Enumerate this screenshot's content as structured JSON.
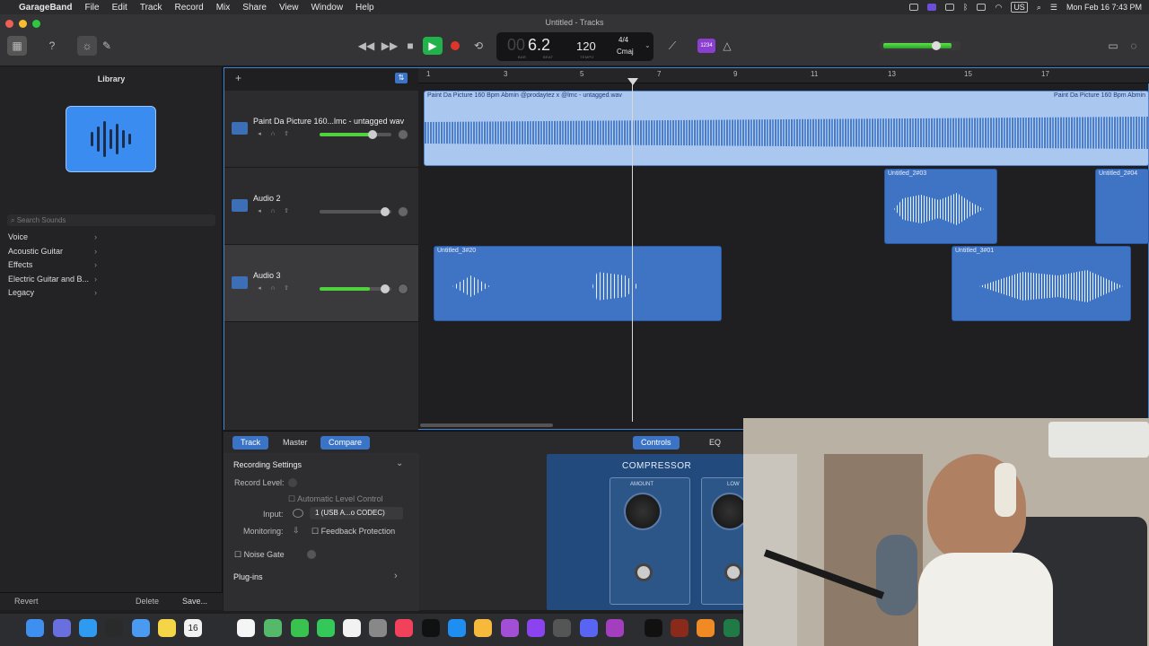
{
  "menubar": {
    "apple": "",
    "app": "GarageBand",
    "items": [
      "File",
      "Edit",
      "Track",
      "Record",
      "Mix",
      "Share",
      "View",
      "Window",
      "Help"
    ],
    "input_source": "US",
    "datetime": "Mon Feb 16  7:43 PM"
  },
  "window": {
    "title": "Untitled - Tracks"
  },
  "lcd": {
    "position": "6.2",
    "position_dim": "00",
    "bar_label": "BAR",
    "beat_label": "BEAT",
    "tempo": "120",
    "tempo_label": "TEMPO",
    "signature": "4/4",
    "key": "Cmaj"
  },
  "count_in_label": "1234",
  "library": {
    "title": "Library",
    "search_placeholder": "Search Sounds",
    "items": [
      {
        "label": "Voice"
      },
      {
        "label": "Acoustic Guitar"
      },
      {
        "label": "Effects"
      },
      {
        "label": "Electric Guitar and B..."
      },
      {
        "label": "Legacy"
      }
    ],
    "revert": "Revert",
    "delete": "Delete",
    "save": "Save..."
  },
  "ruler": {
    "ticks": [
      "1",
      "3",
      "5",
      "7",
      "9",
      "11",
      "13",
      "15",
      "17"
    ]
  },
  "tracks": [
    {
      "name": "Paint Da Picture 160...lmc - untagged wav",
      "volume": 0.75
    },
    {
      "name": "Audio 2",
      "volume": 0.9
    },
    {
      "name": "Audio 3",
      "volume": 0.9
    }
  ],
  "regions": {
    "main_left": "Paint Da Picture 160 Bpm Abmin @prodaytez x @lmc - untagged.wav",
    "main_right": "Paint Da Picture 160 Bpm Abmin",
    "r2a": "Untitled_2#03",
    "r2b": "Untitled_2#04",
    "r3a": "Untitled_3#20",
    "r3b": "Untitled_3#01"
  },
  "smart_controls": {
    "tabs": [
      "Track",
      "Master",
      "Compare"
    ],
    "right_tabs": [
      "Controls",
      "EQ"
    ],
    "recording_settings": "Recording Settings",
    "record_level": "Record Level:",
    "auto_level": "Automatic Level Control",
    "input_label": "Input:",
    "input_value": "1 (USB A...o CODEC)",
    "monitoring": "Monitoring:",
    "feedback": "Feedback Protection",
    "noise_gate": "Noise Gate",
    "plugins": "Plug-ins",
    "compressor": "COMPRESSOR",
    "amount": "AMOUNT",
    "low": "LOW"
  },
  "dock": {
    "calendar_day": "16"
  },
  "colors": {
    "accent": "#3b74c7",
    "region": "#3f74c4",
    "play": "#22b24c",
    "record": "#e0352b"
  }
}
